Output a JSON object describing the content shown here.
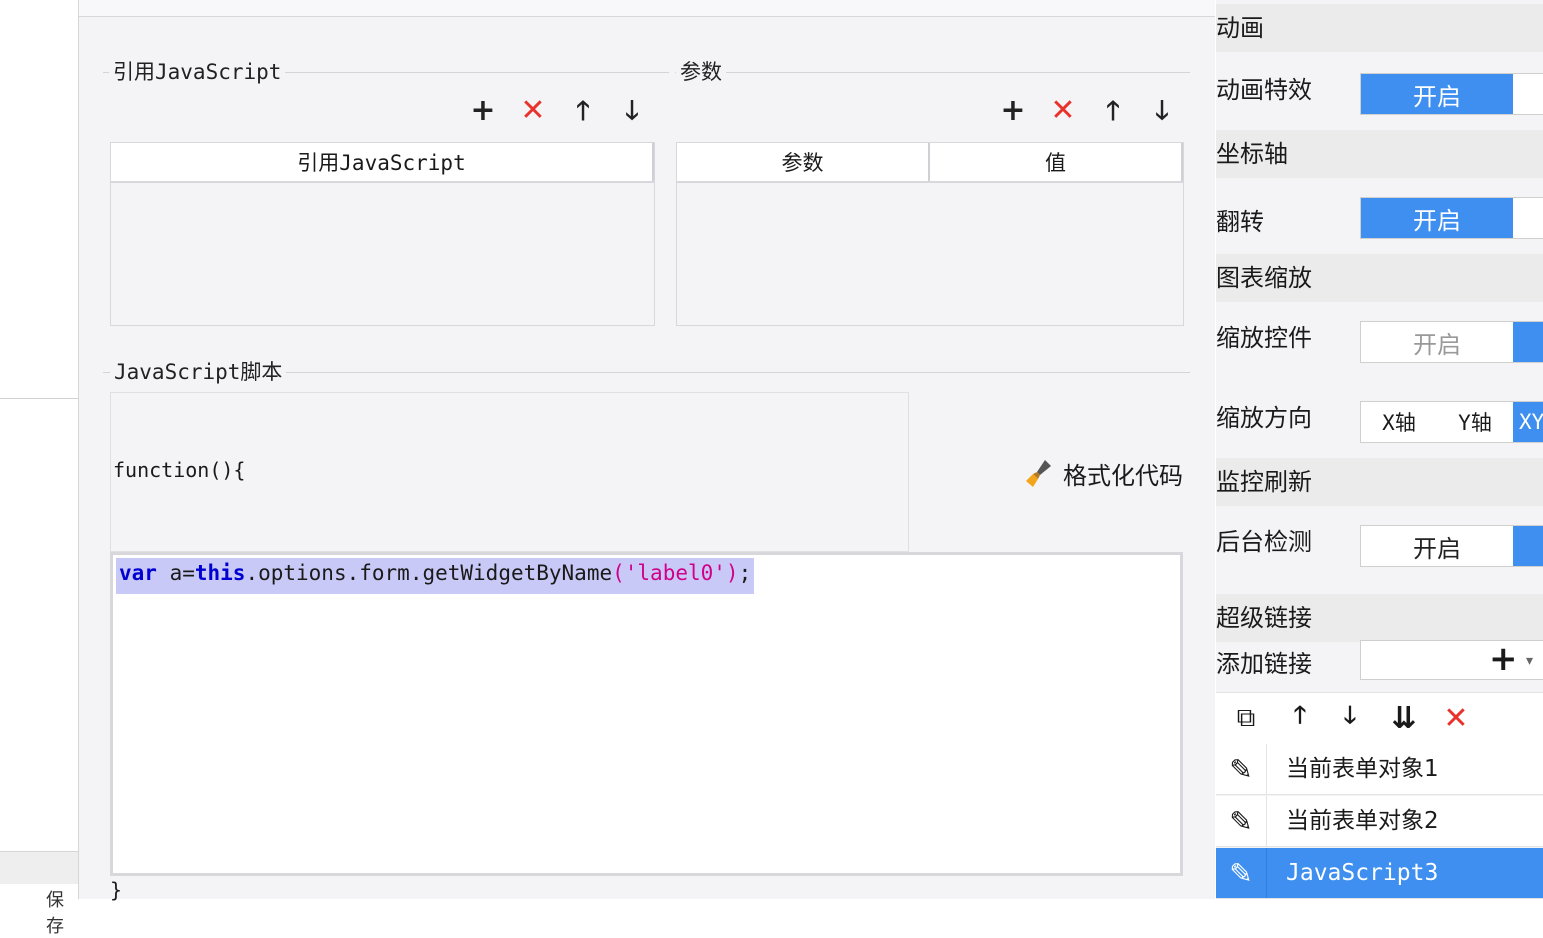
{
  "left": {
    "bottom_tab_label": "保存"
  },
  "ref_js": {
    "title": "引用JavaScript",
    "toolbar": {
      "add": "+",
      "delete": "✕",
      "up": "🡑",
      "down": "🡓"
    },
    "column": "引用JavaScript"
  },
  "params": {
    "title": "参数",
    "toolbar": {
      "add": "+",
      "delete": "✕",
      "up": "🡑",
      "down": "🡓"
    },
    "columns": [
      "参数",
      "值"
    ]
  },
  "script": {
    "title": "JavaScript脚本",
    "func_open": "function(){",
    "func_close": "}",
    "format_label": "格式化代码",
    "code": {
      "kw1": "var",
      "t1": " a=",
      "kw2": "this",
      "t2": ".options.form.getWidgetByName",
      "p1": "(",
      "str": "'label0'",
      "p2": ")",
      "t3": ";"
    }
  },
  "right": {
    "sections": {
      "animation": "动画",
      "axis": "坐标轴",
      "zoom": "图表缩放",
      "monitor": "监控刷新",
      "hyperlink": "超级链接"
    },
    "rows": {
      "anim_effect": {
        "label": "动画特效",
        "value": "开启"
      },
      "flip": {
        "label": "翻转",
        "value": "开启"
      },
      "zoom_ctrl": {
        "label": "缩放控件",
        "value": "开启"
      },
      "zoom_dir": {
        "label": "缩放方向",
        "options": [
          "X轴",
          "Y轴",
          "XY"
        ]
      },
      "bg_check": {
        "label": "后台检测",
        "value": "开启"
      },
      "add_link": {
        "label": "添加链接",
        "plus": "+",
        "caret": "▾"
      }
    },
    "link_toolbar": {
      "copy": "⧉",
      "up": "🡑",
      "down": "🡓",
      "sort": "⇊",
      "delete": "✕"
    },
    "links": [
      {
        "name": "当前表单对象1"
      },
      {
        "name": "当前表单对象2"
      },
      {
        "name": "JavaScript3"
      }
    ]
  }
}
